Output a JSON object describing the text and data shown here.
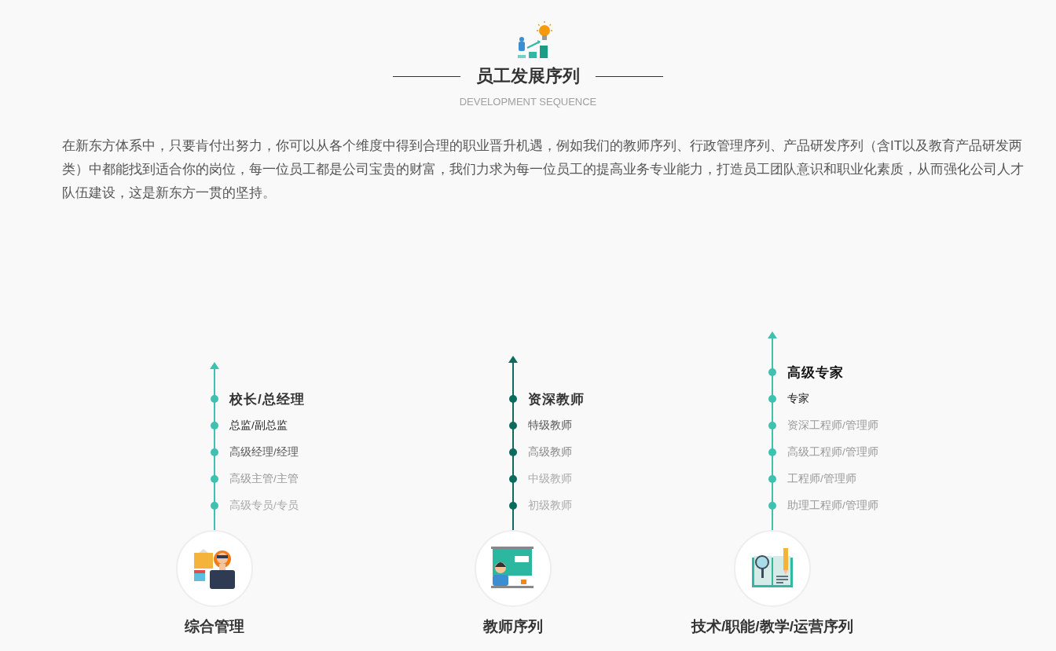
{
  "header": {
    "title": "员工发展序列",
    "subtitle": "DEVELOPMENT SEQUENCE"
  },
  "intro": "在新东方体系中，只要肯付出努力，你可以从各个维度中得到合理的职业晋升机遇，例如我们的教师序列、行政管理序列、产品研发序列（含IT以及教育产品研发两类）中都能找到适合你的岗位，每一位员工都是公司宝贵的财富，我们力求为每一位员工的提高业务专业能力，打造员工团队意识和职业化素质，从而强化公司人才队伍建设，这是新东方一贯的坚持。",
  "tracks": [
    {
      "name": "综合管理",
      "kind": "manager",
      "color": "#3fc1b0",
      "levels": [
        {
          "label": "校长/总经理",
          "color": "#333333"
        },
        {
          "label": "总监/副总监",
          "color": "#222222"
        },
        {
          "label": "高级经理/经理",
          "color": "#555555"
        },
        {
          "label": "高级主管/主管",
          "color": "#999999"
        },
        {
          "label": "高级专员/专员",
          "color": "#aaaaaa"
        }
      ]
    },
    {
      "name": "教师序列",
      "kind": "teacher",
      "color": "#0d6b5e",
      "levels": [
        {
          "label": "资深教师",
          "color": "#333333"
        },
        {
          "label": "特级教师",
          "color": "#555555"
        },
        {
          "label": "高级教师",
          "color": "#888888"
        },
        {
          "label": "中级教师",
          "color": "#aaaaaa"
        },
        {
          "label": "初级教师",
          "color": "#aaaaaa"
        }
      ]
    },
    {
      "name": "技术/职能/教学/运营序列",
      "kind": "research",
      "color": "#3fc1b0",
      "levels": [
        {
          "label": "高级专家",
          "color": "#111111"
        },
        {
          "label": "专家",
          "color": "#222222"
        },
        {
          "label": "资深工程师/管理师",
          "color": "#999999"
        },
        {
          "label": "高级工程师/管理师",
          "color": "#999999"
        },
        {
          "label": "工程师/管理师",
          "color": "#999999"
        },
        {
          "label": "助理工程师/管理师",
          "color": "#999999"
        }
      ]
    }
  ]
}
